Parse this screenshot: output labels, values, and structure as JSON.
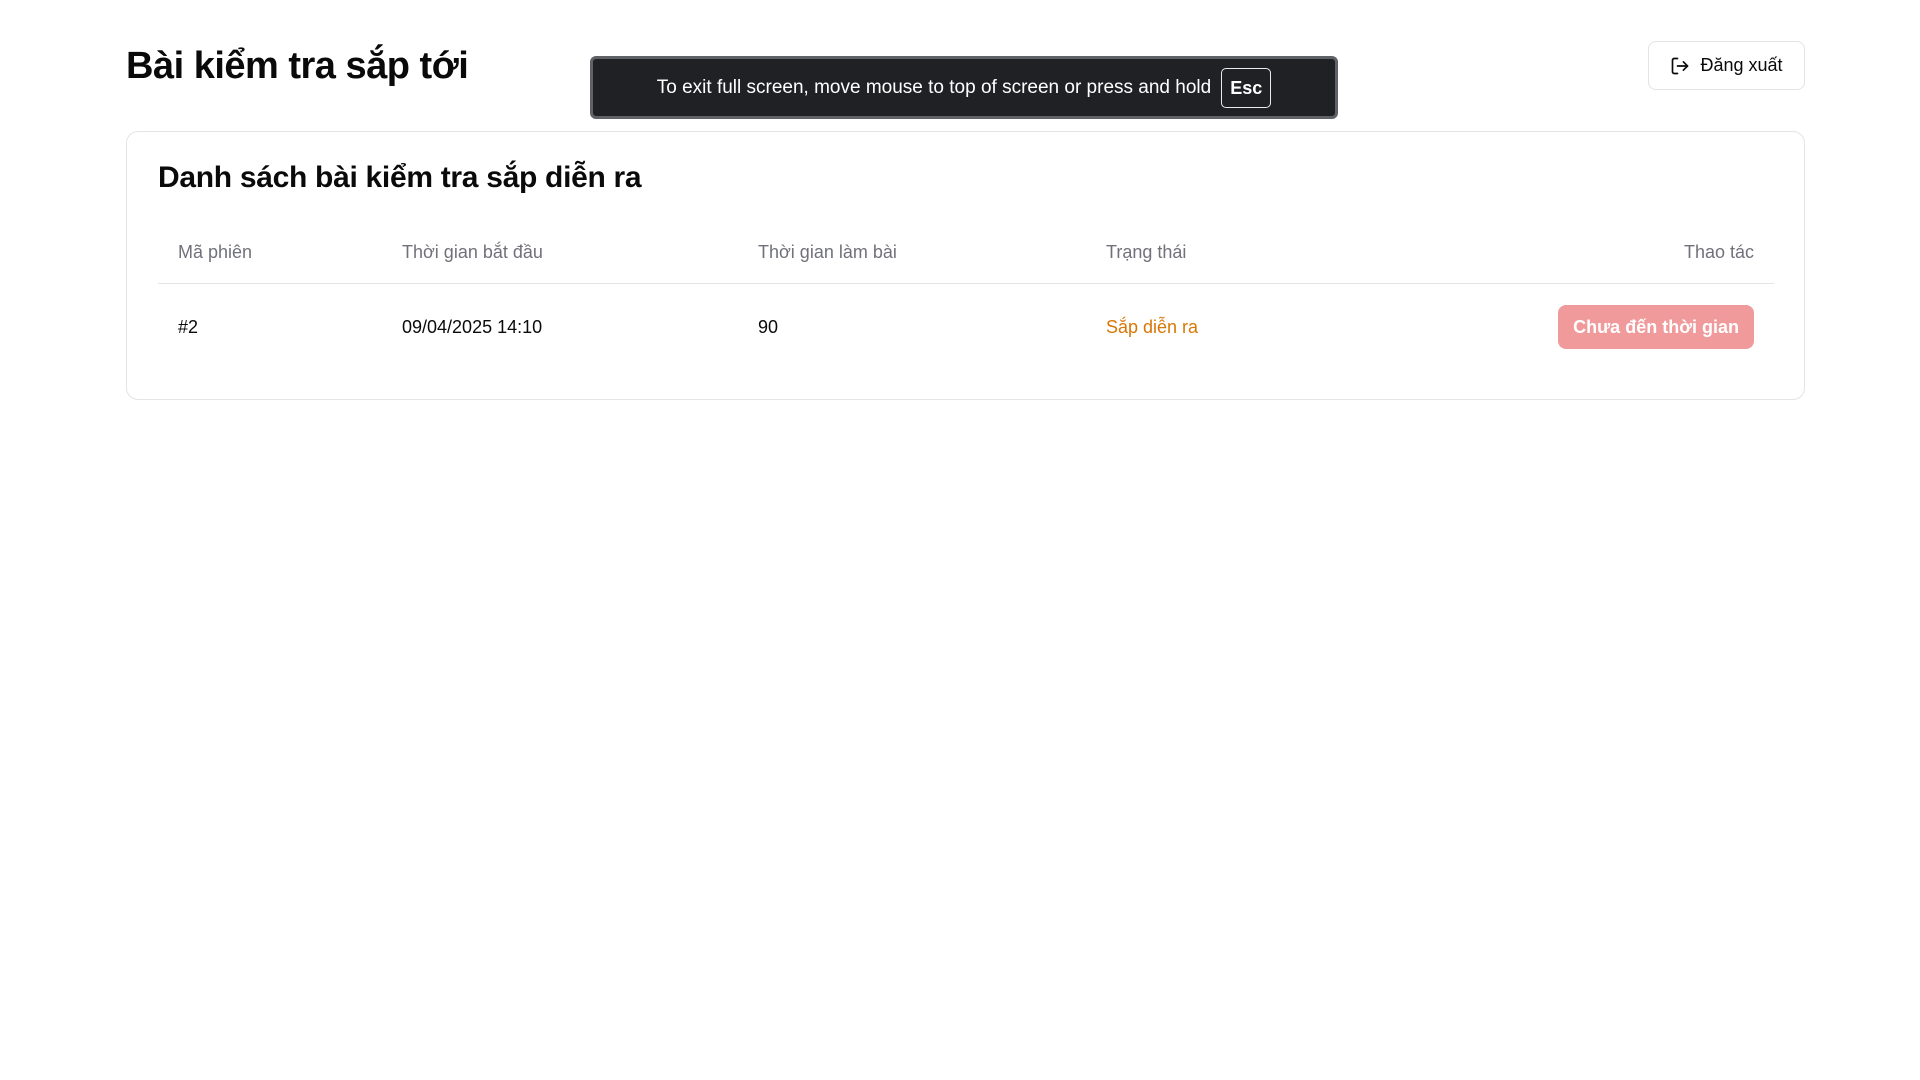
{
  "header": {
    "title": "Bài kiểm tra sắp tới",
    "logout_label": "Đăng xuất",
    "logout_icon": "logout-icon"
  },
  "card": {
    "title": "Danh sách bài kiểm tra sắp diễn ra",
    "columns": [
      "Mã phiên",
      "Thời gian bắt đầu",
      "Thời gian làm bài",
      "Trạng thái",
      "Thao tác"
    ],
    "rows": [
      {
        "session_id": "#2",
        "start_time": "09/04/2025 14:10",
        "duration": "90",
        "status": "Sắp diễn ra",
        "action_label": "Chưa đến thời gian"
      }
    ]
  },
  "fullscreen_notice": {
    "message": "To exit full screen, move mouse to top of screen or press and hold",
    "key": "Esc"
  },
  "colors": {
    "status_upcoming": "#d97706",
    "action_disabled_bg": "#f19a9b",
    "border": "#e4e4e7",
    "toast_bg": "#202124"
  }
}
